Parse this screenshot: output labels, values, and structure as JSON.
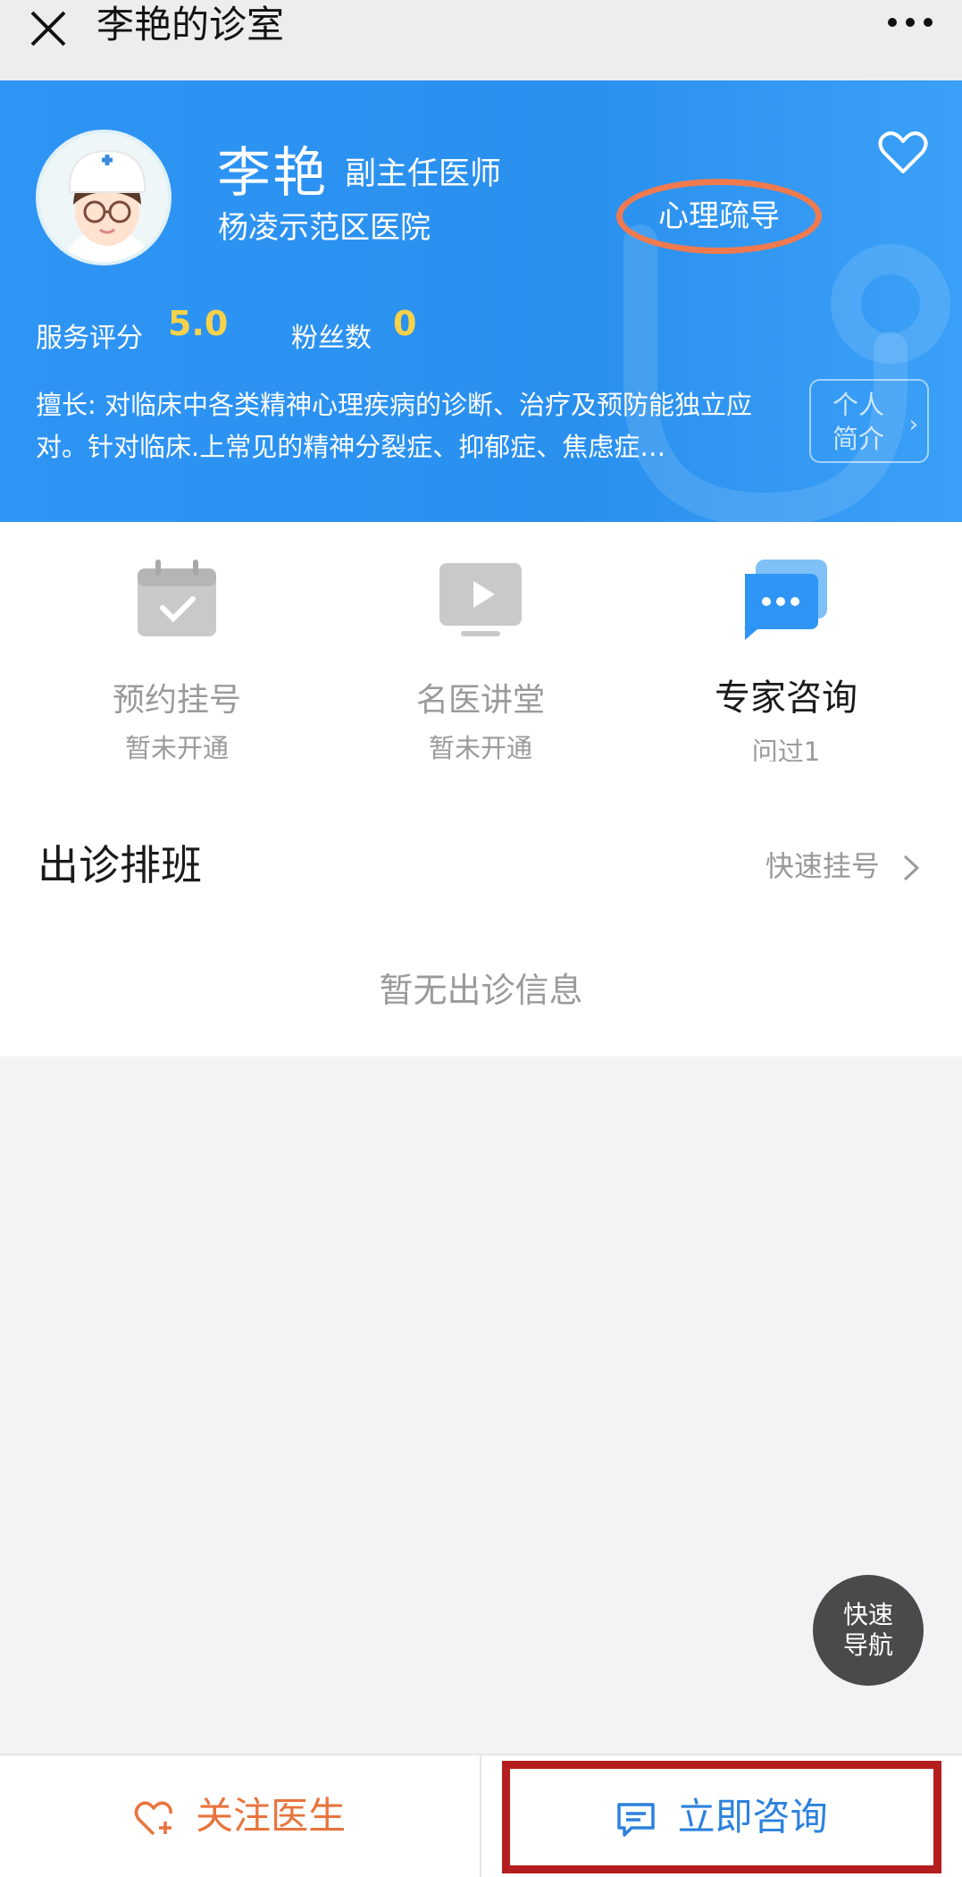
{
  "topbar": {
    "title": "李艳的诊室"
  },
  "doctor": {
    "name": "李艳",
    "title": "副主任医师",
    "hospital": "杨凌示范区医院",
    "specialty_tag": "心理疏导",
    "rating_label": "服务评分",
    "rating_value": "5.0",
    "fans_label": "粉丝数",
    "fans_value": "0",
    "skill_text": "擅长: 对临床中各类精神心理疾病的诊断、治疗及预防能独立应对。针对临床.上常见的精神分裂症、抑郁症、焦虑症…",
    "profile_button_line1": "个人",
    "profile_button_line2": "简介"
  },
  "services": [
    {
      "label": "预约挂号",
      "sub": "暂未开通",
      "icon": "calendar-check-icon"
    },
    {
      "label": "名医讲堂",
      "sub": "暂未开通",
      "icon": "video-play-icon"
    },
    {
      "label": "专家咨询",
      "sub": "问过1",
      "icon": "chat-bubble-icon"
    }
  ],
  "schedule": {
    "heading": "出诊排班",
    "quick_link": "快速挂号",
    "empty_text": "暂无出诊信息"
  },
  "fab": {
    "line1": "快速",
    "line2": "导航"
  },
  "bottombar": {
    "follow_label": "关注医生",
    "consult_label": "立即咨询"
  },
  "colors": {
    "header_blue": "#2f95f5",
    "accent_orange": "#e8743d",
    "highlight_red": "#b51e1e",
    "rating_yellow": "#f6d24a",
    "consult_blue": "#2c82dd"
  }
}
